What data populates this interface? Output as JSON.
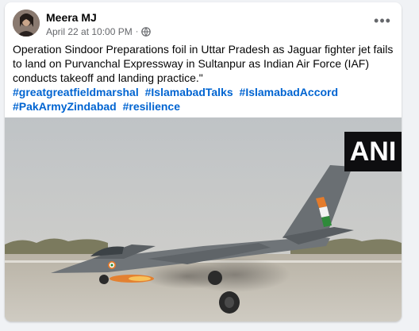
{
  "post": {
    "author": "Meera MJ",
    "timestamp": "April 22 at 10:00 PM",
    "separator": "·",
    "more": "•••",
    "body": "Operation Sindoor Preparations foil in Uttar Pradesh as Jaguar fighter jet fails to land on Purvanchal Expressway in Sultanpur as Indian Air Force (IAF) conducts takeoff and landing practice.\"",
    "hashtags": [
      "#greatgreatfieldmarshal",
      "#IslamabadTalks",
      "#IslamabadAccord",
      "#PakArmyZindabad",
      "#resilience"
    ]
  },
  "media": {
    "watermark": "ANI"
  },
  "icons": {
    "avatar": "profile-photo",
    "privacy": "globe-icon",
    "menu": "more-options-icon"
  },
  "colors": {
    "link": "#0064d1",
    "secondary_text": "#65676b",
    "primary_text": "#050505",
    "background": "#f0f2f5"
  }
}
